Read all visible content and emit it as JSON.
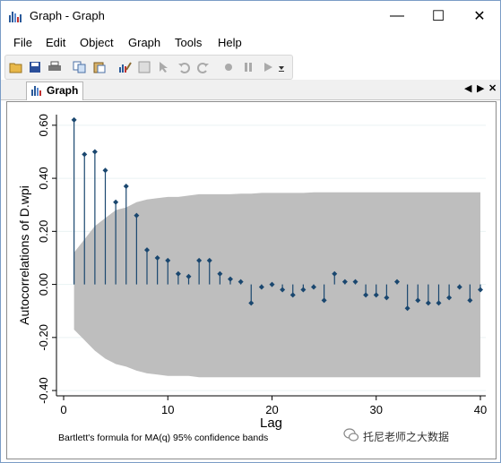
{
  "window": {
    "title": "Graph - Graph",
    "minimize_glyph": "—",
    "maximize_glyph": "☐",
    "close_glyph": "✕"
  },
  "menu": [
    "File",
    "Edit",
    "Object",
    "Graph",
    "Tools",
    "Help"
  ],
  "toolbar": {
    "icons": [
      "open-folder-icon",
      "save-icon",
      "print-icon",
      "copy-icon",
      "paste-icon",
      "graph-editor-icon",
      "properties-icon",
      "pointer-icon",
      "undo-icon",
      "redo-icon",
      "play-icon",
      "record-icon",
      "pause-icon",
      "step-icon"
    ]
  },
  "tab": {
    "label": "Graph",
    "nav_left": "◀",
    "nav_right": "▶",
    "close": "✕"
  },
  "watermark": "托尼老师之大数据",
  "colors": {
    "band": "#bebebe",
    "marker": "#1a476f",
    "grid": "#eaf2f3"
  },
  "chart_data": {
    "type": "scatter",
    "subtype": "correlogram",
    "xlabel": "Lag",
    "ylabel": "Autocorrelations of D.wpi",
    "note": "Bartlett's formula for MA(q) 95% confidence bands",
    "xlim": [
      0,
      40
    ],
    "ylim": [
      -0.4,
      0.6
    ],
    "xticks": [
      0,
      10,
      20,
      30,
      40
    ],
    "yticks": [
      -0.4,
      -0.2,
      0.0,
      0.2,
      0.4,
      0.6
    ],
    "ytick_labels": [
      "-0.40",
      "-0.20",
      "0.00",
      "0.20",
      "0.40",
      "0.60"
    ],
    "grid": true,
    "lags": [
      1,
      2,
      3,
      4,
      5,
      6,
      7,
      8,
      9,
      10,
      11,
      12,
      13,
      14,
      15,
      16,
      17,
      18,
      19,
      20,
      21,
      22,
      23,
      24,
      25,
      26,
      27,
      28,
      29,
      30,
      31,
      32,
      33,
      34,
      35,
      36,
      37,
      38,
      39,
      40
    ],
    "acf": [
      0.62,
      0.49,
      0.5,
      0.43,
      0.31,
      0.37,
      0.26,
      0.13,
      0.1,
      0.09,
      0.04,
      0.03,
      0.09,
      0.09,
      0.04,
      0.02,
      0.01,
      -0.07,
      -0.01,
      0.0,
      -0.02,
      -0.04,
      -0.02,
      -0.01,
      -0.06,
      0.04,
      0.01,
      0.01,
      -0.04,
      -0.04,
      -0.05,
      0.01,
      -0.09,
      -0.06,
      -0.07,
      -0.07,
      -0.05,
      -0.01,
      -0.06,
      -0.02
    ],
    "band_upper": [
      0.12,
      0.17,
      0.22,
      0.25,
      0.28,
      0.29,
      0.31,
      0.32,
      0.325,
      0.33,
      0.33,
      0.335,
      0.34,
      0.34,
      0.34,
      0.34,
      0.342,
      0.342,
      0.345,
      0.345,
      0.345,
      0.345,
      0.345,
      0.347,
      0.347,
      0.347,
      0.347,
      0.347,
      0.347,
      0.347,
      0.347,
      0.347,
      0.347,
      0.347,
      0.347,
      0.347,
      0.347,
      0.347,
      0.347,
      0.347
    ],
    "band_lower": [
      -0.17,
      -0.21,
      -0.25,
      -0.28,
      -0.3,
      -0.31,
      -0.325,
      -0.335,
      -0.34,
      -0.345,
      -0.345,
      -0.345,
      -0.35,
      -0.35,
      -0.35,
      -0.35,
      -0.35,
      -0.35,
      -0.35,
      -0.35,
      -0.35,
      -0.35,
      -0.35,
      -0.35,
      -0.35,
      -0.35,
      -0.35,
      -0.35,
      -0.35,
      -0.35,
      -0.35,
      -0.35,
      -0.35,
      -0.35,
      -0.35,
      -0.35,
      -0.35,
      -0.35,
      -0.35,
      -0.35
    ]
  }
}
